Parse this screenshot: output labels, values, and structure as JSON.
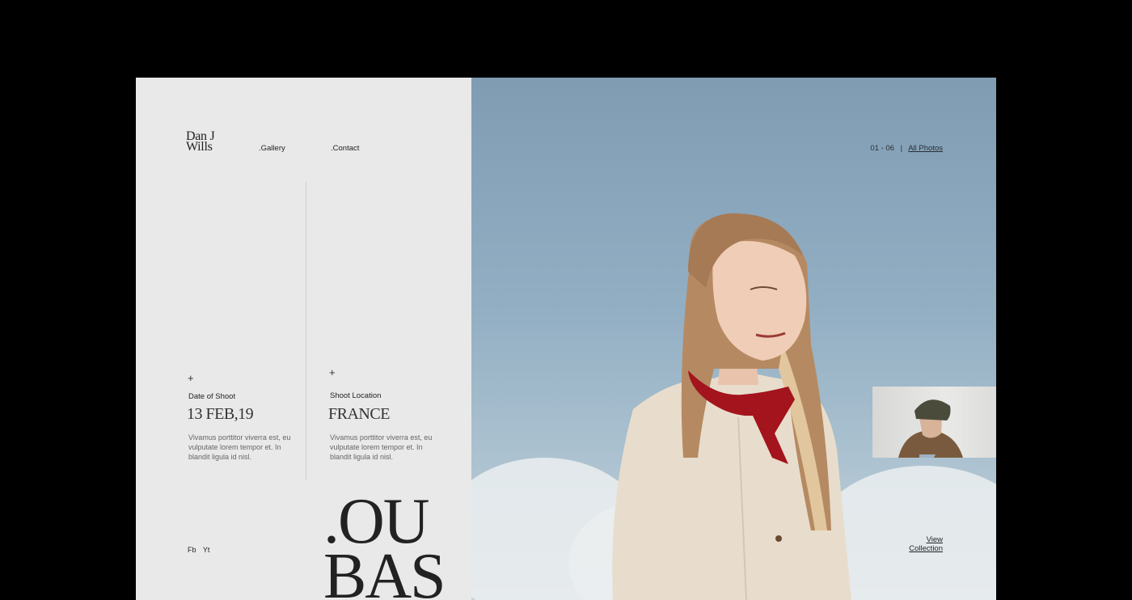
{
  "brand": {
    "line1": "Dan J",
    "line2": "Wills"
  },
  "nav": {
    "gallery": ".Gallery",
    "contact": ".Contact"
  },
  "left": {
    "date": {
      "plus": "+",
      "label": "Date of Shoot",
      "value": "13 FEB,19",
      "description": "Vivamus porttitor viverra est, eu vulputate lorem tempor et. In blandit ligula id nisl."
    },
    "location": {
      "plus": "+",
      "label": "Shoot Location",
      "value": "FRANCE",
      "description": "Vivamus porttitor viverra est, eu vulputate lorem tempor et. In blandit ligula id nisl."
    },
    "social": {
      "fb": "Fb",
      "yt": "Yt"
    },
    "big_title": {
      "line1": ".OU",
      "line2": "BAS"
    }
  },
  "hero": {
    "counter": "01 - 06",
    "separator": "|",
    "all_photos": "All Photos",
    "view_collection_line1": "View",
    "view_collection_line2": "Collection"
  },
  "colors": {
    "panel_bg": "#e9e9e9",
    "sky": "#93afc4",
    "scarf": "#a3141c",
    "text": "#222222"
  }
}
